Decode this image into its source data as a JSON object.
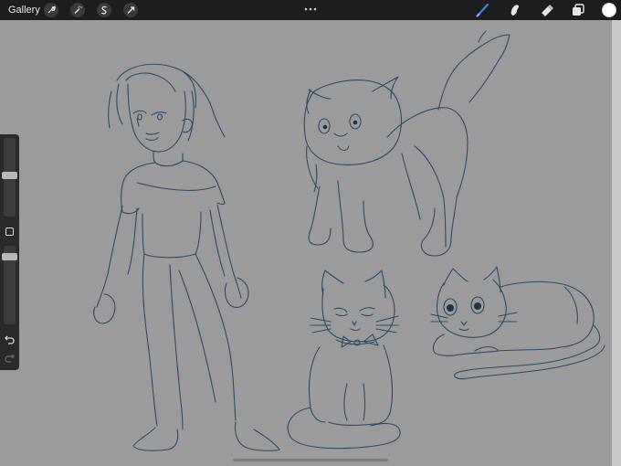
{
  "app": {
    "gallery_label": "Gallery"
  },
  "toolbar": {
    "left_tools": [
      "wrench-icon",
      "magic-wand-icon",
      "selection-icon",
      "transform-icon"
    ],
    "right_tools": [
      "brush-icon",
      "smudge-icon",
      "eraser-icon",
      "layers-icon",
      "color-swatch"
    ],
    "active_tool": "brush-icon",
    "accent_color": "#3b82f6",
    "current_color": "#ffffff"
  },
  "sidebar": {
    "brush_size_level": 0.52,
    "opacity_level": 0.9,
    "icons": [
      "modify-square-icon",
      "undo-icon",
      "redo-icon"
    ]
  },
  "canvas": {
    "background": "#9b9b9b",
    "sketches": [
      "girl-figure",
      "standing-cat",
      "sitting-cat-with-bow",
      "lying-cat"
    ]
  }
}
